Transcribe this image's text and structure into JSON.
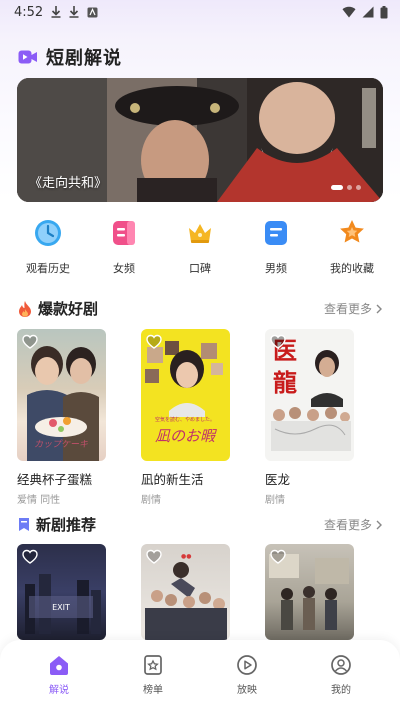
{
  "status_bar": {
    "time": "4:52"
  },
  "header": {
    "title": "短剧解说"
  },
  "banner": {
    "caption": "《走向共和》",
    "slides": 3,
    "active_slide": 1
  },
  "quick_nav": [
    {
      "label": "观看历史",
      "icon": "clock-icon",
      "color": "#38a8f0"
    },
    {
      "label": "女频",
      "icon": "female-book-icon",
      "color": "#f0508a"
    },
    {
      "label": "口碑",
      "icon": "crown-icon",
      "color": "#f5b622"
    },
    {
      "label": "男频",
      "icon": "male-book-icon",
      "color": "#3a8cf5"
    },
    {
      "label": "我的收藏",
      "icon": "star-icon",
      "color": "#f28a1e"
    }
  ],
  "hot_section": {
    "title": "爆款好剧",
    "more": "查看更多",
    "items": [
      {
        "title": "经典杯子蛋糕",
        "tags": "爱情 同性",
        "poster": "poster-cupcake"
      },
      {
        "title": "凪的新生活",
        "tags": "剧情",
        "poster": "poster-nagi"
      },
      {
        "title": "医龙",
        "tags": "剧情",
        "poster": "poster-iryu"
      }
    ]
  },
  "new_section": {
    "title": "新剧推荐",
    "more": "查看更多",
    "items": [
      {
        "poster": "poster-city"
      },
      {
        "poster": "poster-crowd"
      },
      {
        "poster": "poster-street"
      }
    ]
  },
  "bottom_nav": [
    {
      "label": "解说",
      "icon": "explain-icon",
      "active": true
    },
    {
      "label": "榜单",
      "icon": "ranking-icon",
      "active": false
    },
    {
      "label": "放映",
      "icon": "play-icon",
      "active": false
    },
    {
      "label": "我的",
      "icon": "profile-icon",
      "active": false
    }
  ],
  "colors": {
    "accent": "#8b5cf6",
    "hot_flame": "#f05a3a",
    "new_badge": "#6d7cf5"
  }
}
